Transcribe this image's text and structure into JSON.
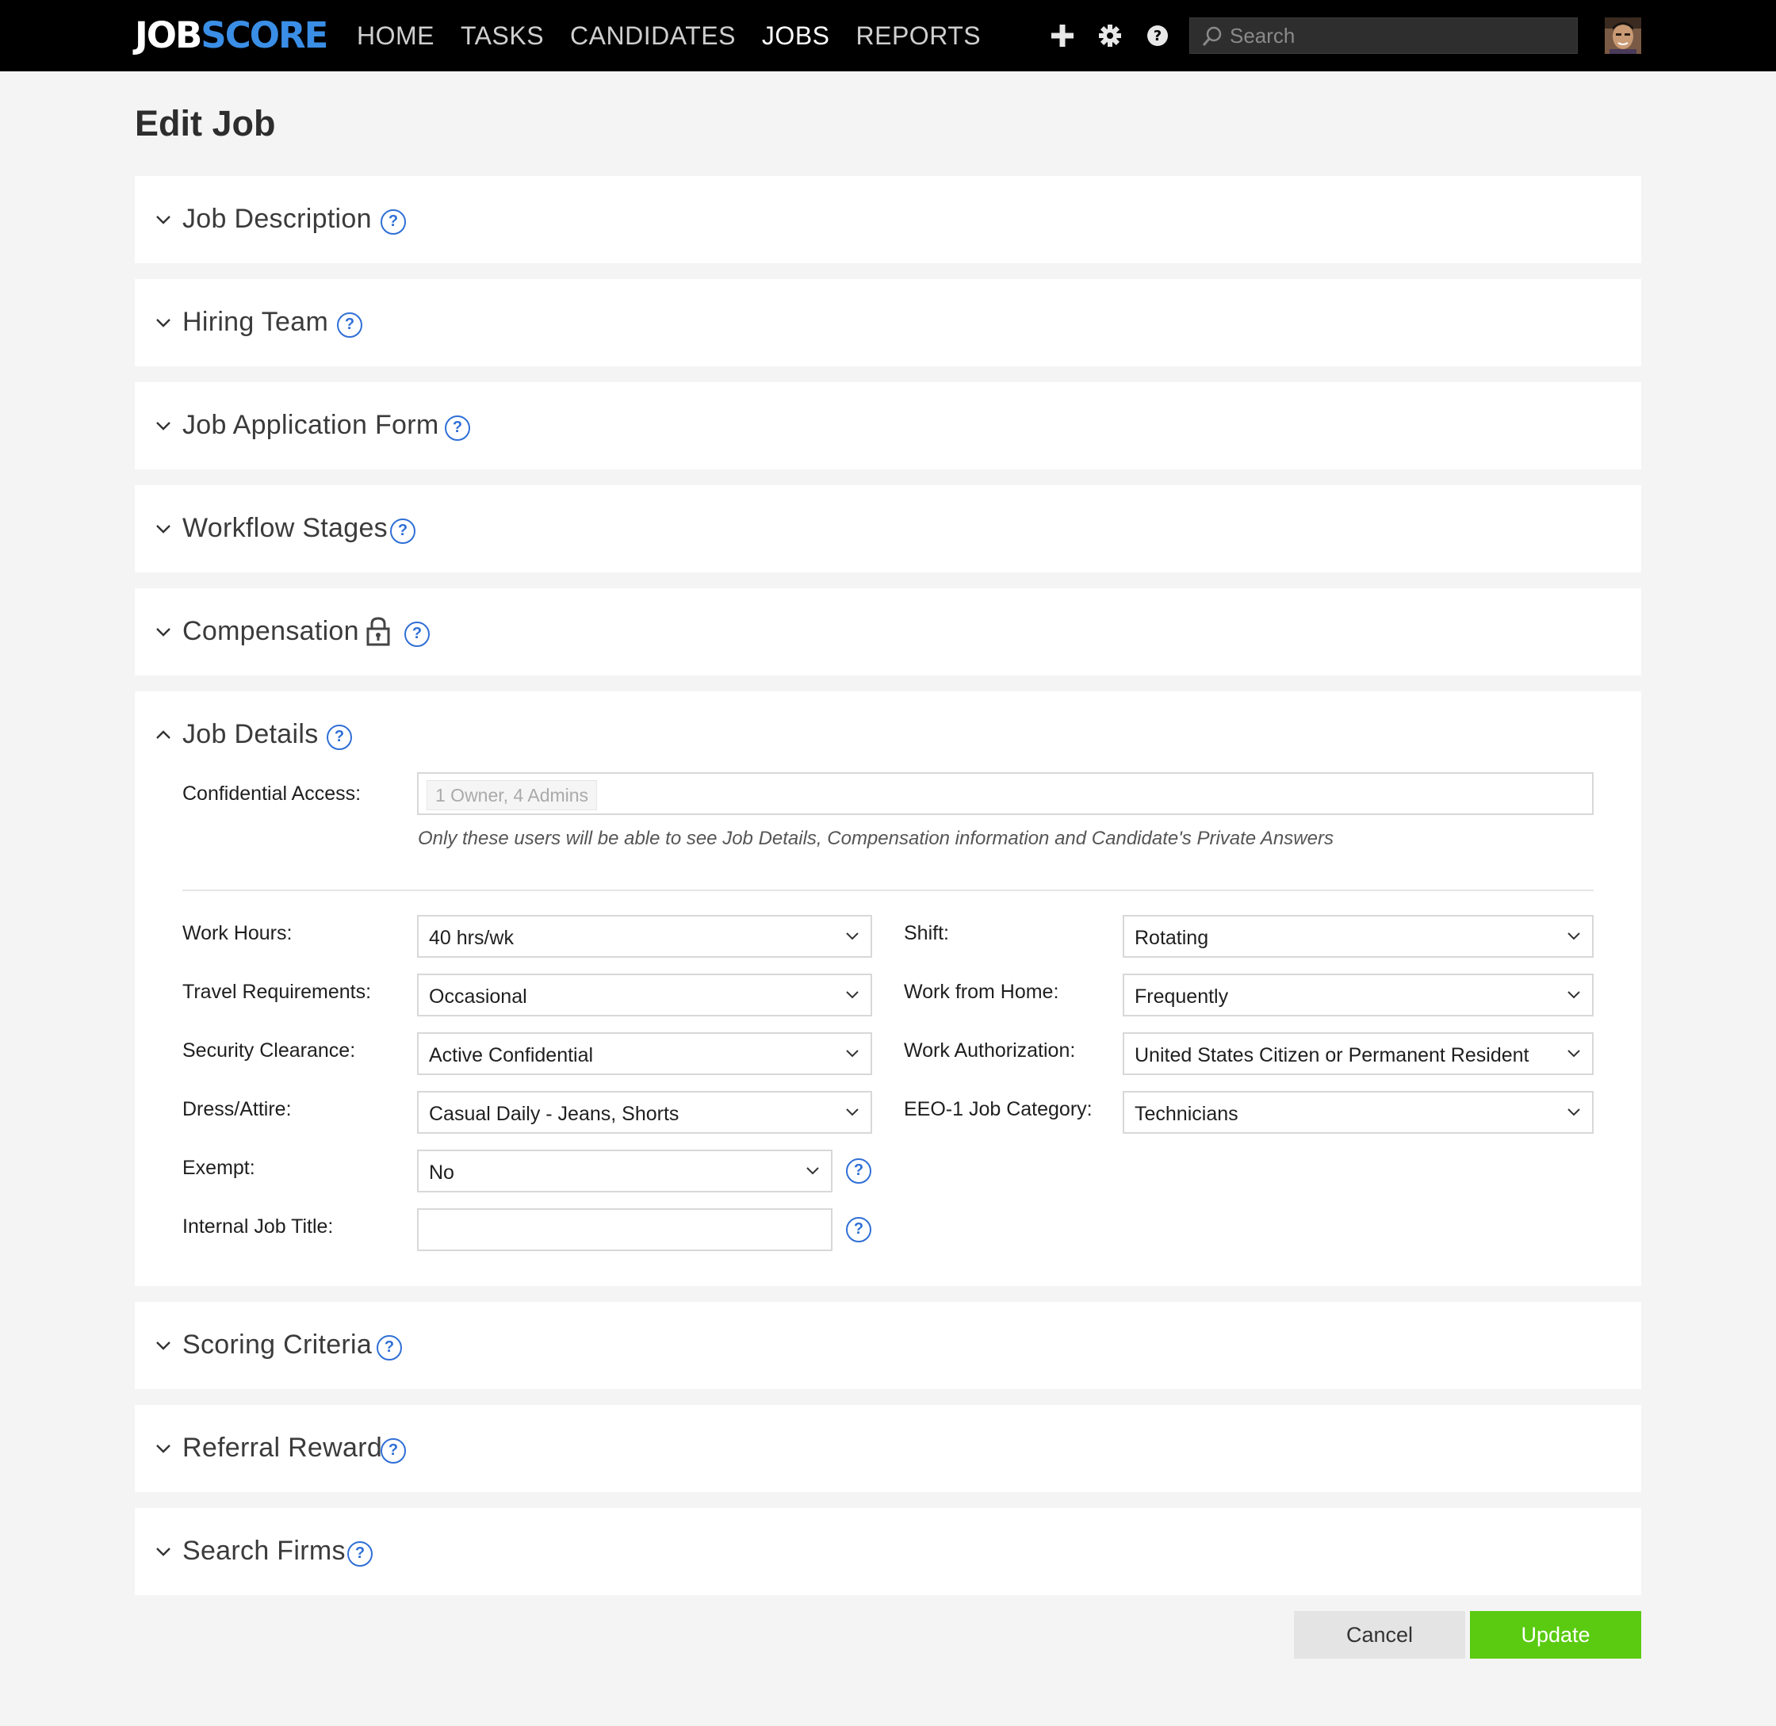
{
  "header": {
    "logo_part1": "JOB",
    "logo_part2": "SCORE",
    "nav": [
      {
        "label": "HOME",
        "active": false
      },
      {
        "label": "TASKS",
        "active": false
      },
      {
        "label": "CANDIDATES",
        "active": false
      },
      {
        "label": "JOBS",
        "active": true
      },
      {
        "label": "REPORTS",
        "active": false
      }
    ],
    "icons": [
      "plus-icon",
      "gear-icon",
      "help-icon"
    ],
    "search_placeholder": "Search"
  },
  "page_title": "Edit Job",
  "sections": {
    "job_description": "Job Description",
    "hiring_team": "Hiring Team",
    "job_application_form": "Job Application Form",
    "workflow_stages": "Workflow Stages",
    "compensation": "Compensation",
    "job_details": "Job Details",
    "scoring_criteria": "Scoring Criteria",
    "referral_reward": "Referral Reward",
    "search_firms": "Search Firms"
  },
  "job_details": {
    "confidential_access_label": "Confidential Access:",
    "confidential_access_value": "1 Owner, 4 Admins",
    "confidential_hint": "Only these users will be able to see Job Details, Compensation information and Candidate's Private Answers",
    "work_hours_label": "Work Hours:",
    "work_hours_value": "40 hrs/wk",
    "travel_label": "Travel Requirements:",
    "travel_value": "Occasional",
    "security_label": "Security Clearance:",
    "security_value": "Active Confidential",
    "dress_label": "Dress/Attire:",
    "dress_value": "Casual Daily - Jeans, Shorts",
    "exempt_label": "Exempt:",
    "exempt_value": "No",
    "internal_title_label": "Internal Job Title:",
    "internal_title_value": "",
    "shift_label": "Shift:",
    "shift_value": "Rotating",
    "wfh_label": "Work from Home:",
    "wfh_value": "Frequently",
    "work_auth_label": "Work Authorization:",
    "work_auth_value": "United States Citizen or Permanent Resident",
    "eeo_label": "EEO-1 Job Category:",
    "eeo_value": "Technicians"
  },
  "buttons": {
    "cancel": "Cancel",
    "update": "Update"
  },
  "colors": {
    "topbar": "#000000",
    "logo_accent": "#3a8ee6",
    "help_blue": "#2f6fd6",
    "update_green": "#5acb10"
  }
}
